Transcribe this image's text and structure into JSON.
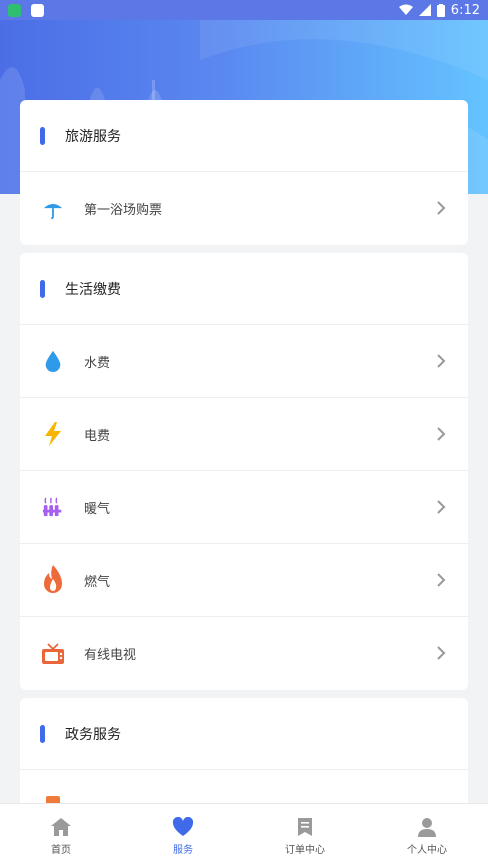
{
  "status_bar": {
    "time": "6:12"
  },
  "sections": [
    {
      "title": "旅游服务",
      "items": [
        {
          "label": "第一浴场购票",
          "icon": "umbrella-icon"
        }
      ]
    },
    {
      "title": "生活缴费",
      "items": [
        {
          "label": "水费",
          "icon": "water-drop-icon"
        },
        {
          "label": "电费",
          "icon": "lightning-icon"
        },
        {
          "label": "暖气",
          "icon": "heater-icon"
        },
        {
          "label": "燃气",
          "icon": "flame-icon"
        },
        {
          "label": "有线电视",
          "icon": "tv-icon"
        }
      ]
    },
    {
      "title": "政务服务",
      "items": []
    }
  ],
  "tabbar": [
    {
      "label": "首页",
      "icon": "home-icon"
    },
    {
      "label": "服务",
      "icon": "heart-icon",
      "active": true
    },
    {
      "label": "订单中心",
      "icon": "bookmark-icon"
    },
    {
      "label": "个人中心",
      "icon": "person-icon"
    }
  ],
  "colors": {
    "accent": "#3f6bea",
    "hero_start": "#4b6ee6",
    "hero_end": "#64c3ff"
  }
}
